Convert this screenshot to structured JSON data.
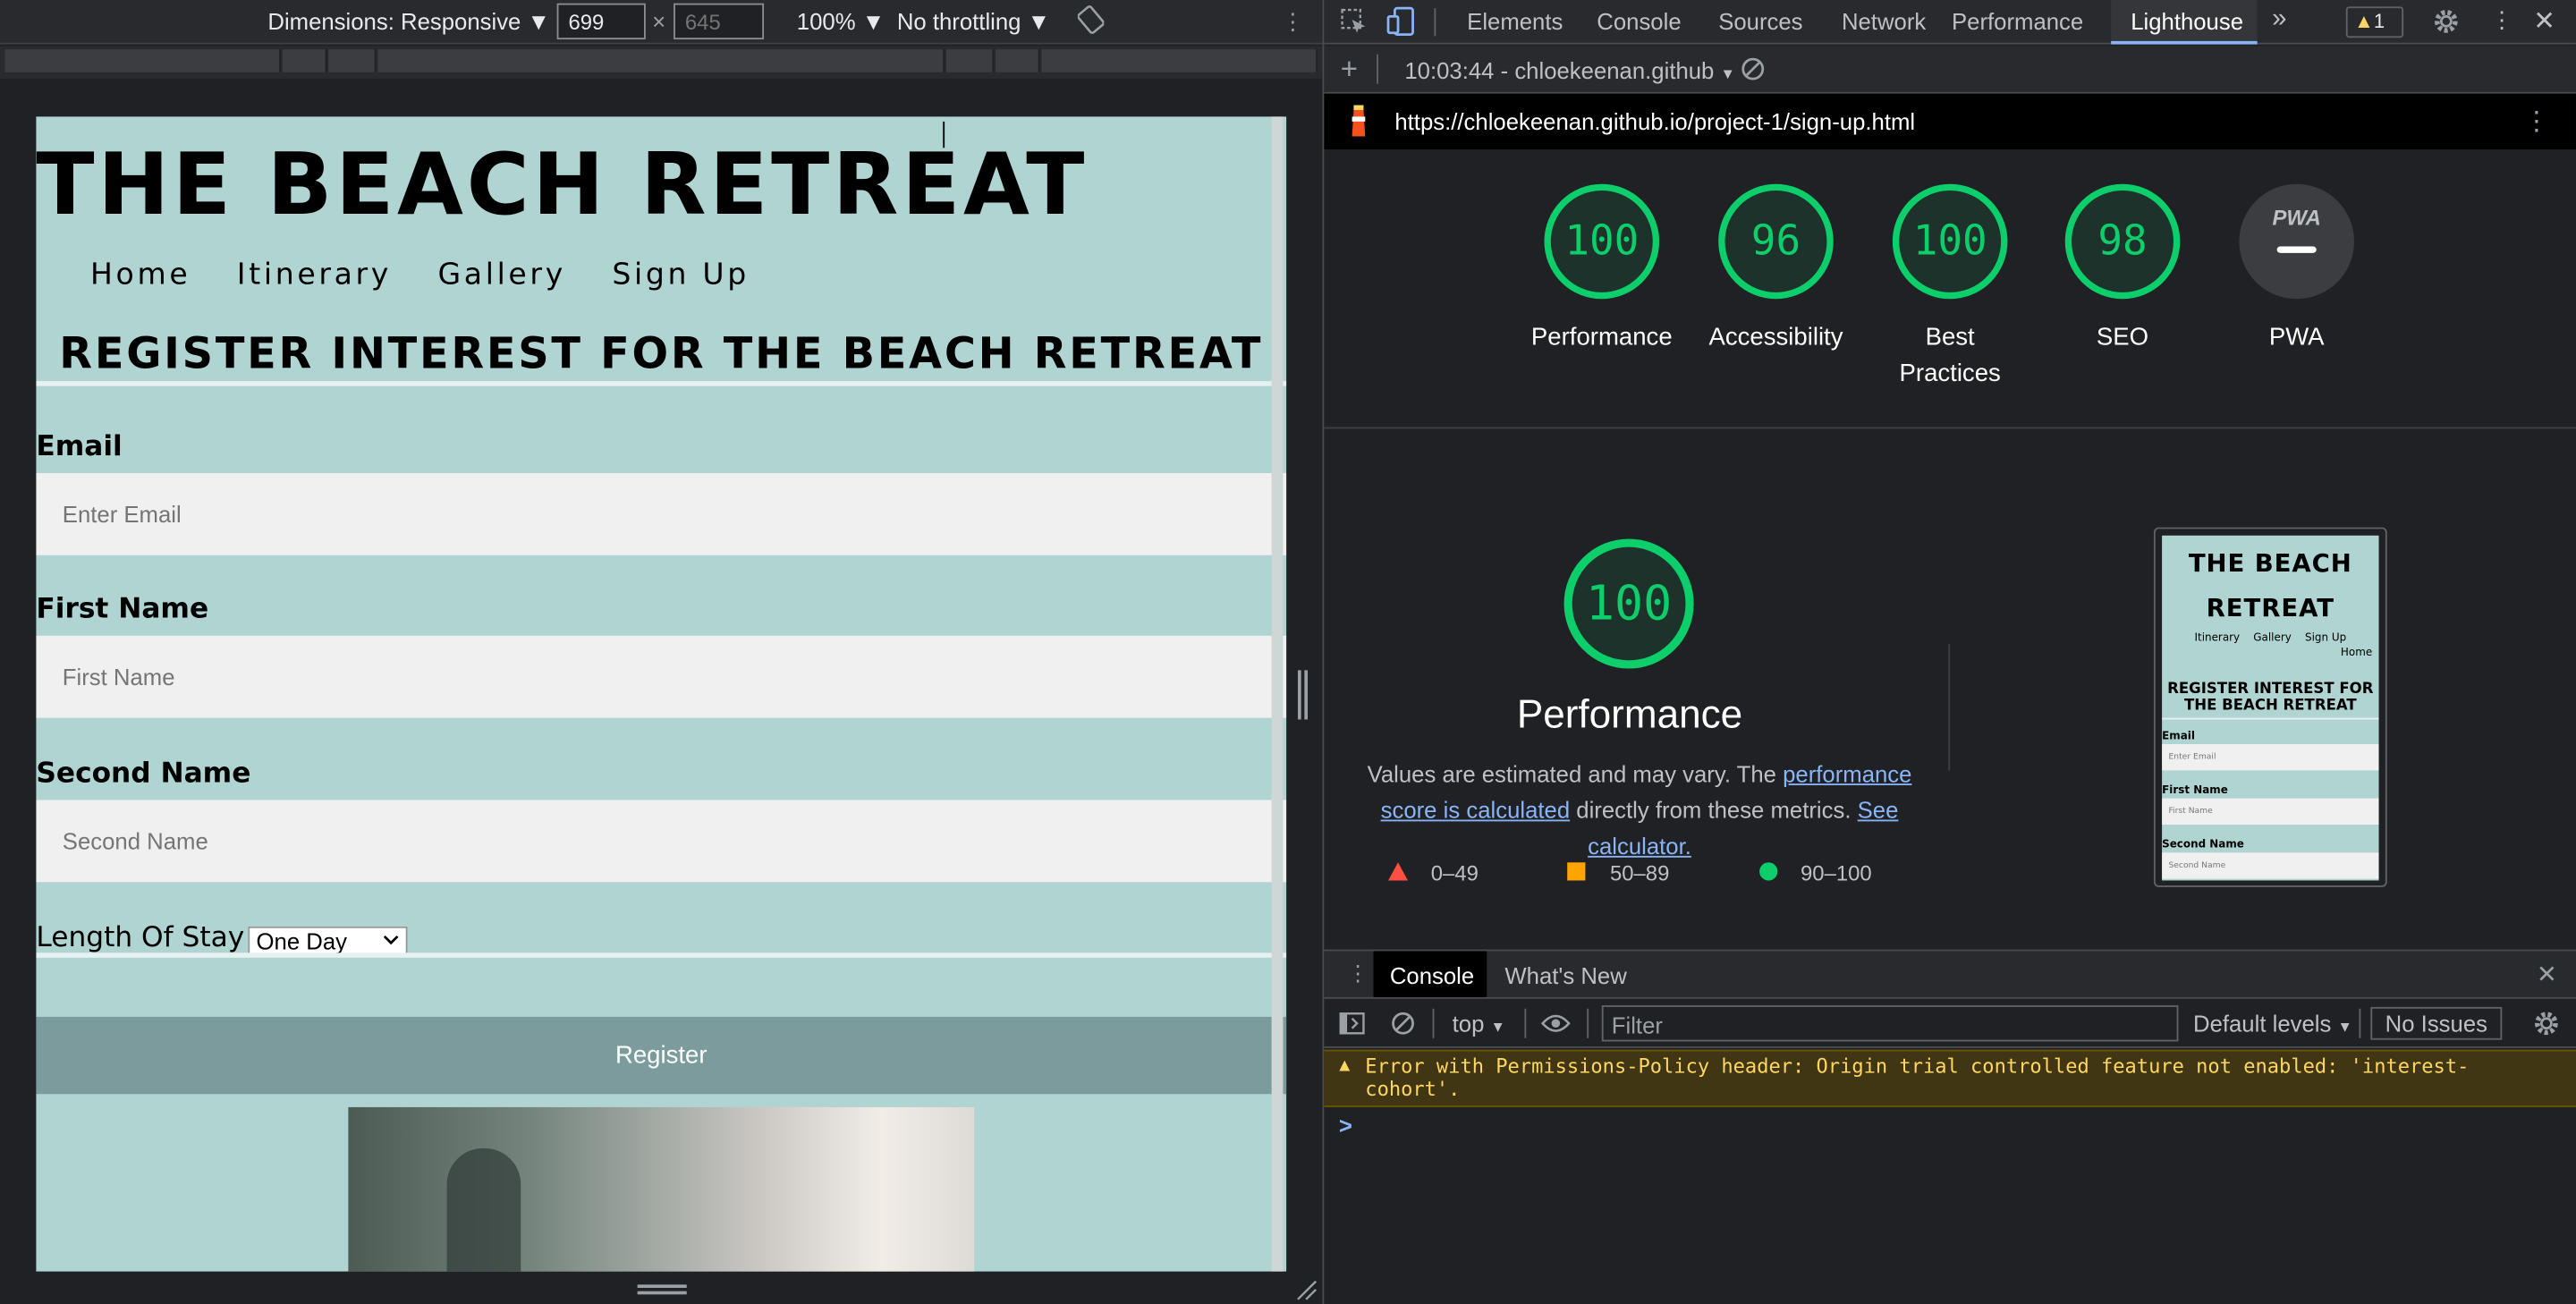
{
  "device_toolbar": {
    "dimensions": "Dimensions: Responsive",
    "width_value": "699",
    "height_placeholder": "645",
    "zoom": "100%",
    "throttling": "No throttling"
  },
  "site": {
    "title": "THE BEACH RETREAT",
    "nav": [
      "Home",
      "Itinerary",
      "Gallery",
      "Sign Up"
    ],
    "heading": "REGISTER INTEREST FOR THE BEACH RETREAT",
    "email_label": "Email",
    "email_placeholder": "Enter Email",
    "first_label": "First Name",
    "first_placeholder": "First Name",
    "second_label": "Second Name",
    "second_placeholder": "Second Name",
    "stay_label": "Length Of Stay",
    "stay_value": "One Day",
    "register_button": "Register"
  },
  "devtools": {
    "tabs": [
      "Elements",
      "Console",
      "Sources",
      "Network",
      "Performance",
      "Lighthouse"
    ],
    "active_tab": "Lighthouse",
    "warning_count": "1",
    "report_time": "10:03:44 - chloekeenan.github",
    "url": "https://chloekeenan.github.io/project-1/sign-up.html",
    "scores": [
      {
        "label": "Performance",
        "value": "100"
      },
      {
        "label": "Accessibility",
        "value": "96"
      },
      {
        "label": "Best Practices",
        "value": "100"
      },
      {
        "label": "SEO",
        "value": "98"
      }
    ],
    "pwa_label": "PWA",
    "pwa_badge": "PWA",
    "perf_score": "100",
    "perf_title": "Performance",
    "perf_desc_1": "Values are estimated and may vary. The ",
    "perf_link_1": "performance score is calculated",
    "perf_desc_2": " directly from these metrics. ",
    "perf_link_2": "See calculator.",
    "legend": [
      "0–49",
      "50–89",
      "90–100"
    ],
    "thumb": {
      "title": "THE BEACH RETREAT",
      "nav": "Itinerary    Gallery    Sign Up",
      "nav2": "Home",
      "heading": "REGISTER INTEREST FOR THE BEACH RETREAT",
      "email": "Email",
      "email_ph": "Enter Email",
      "first": "First Name",
      "first_ph": "First Name",
      "second": "Second Name",
      "second_ph": "Second Name"
    }
  },
  "console": {
    "tabs": [
      "Console",
      "What's New"
    ],
    "context": "top",
    "filter_placeholder": "Filter",
    "levels": "Default levels",
    "issues": "No Issues",
    "warning": "Error with Permissions-Policy header: Origin trial controlled feature not enabled: 'interest-cohort'.",
    "prompt": ">"
  },
  "colors": {
    "site_bg": "#afd4d2",
    "good": "#0cce6b",
    "average": "#ffa400",
    "fail": "#ff4e42",
    "warning_bg": "#413614"
  }
}
